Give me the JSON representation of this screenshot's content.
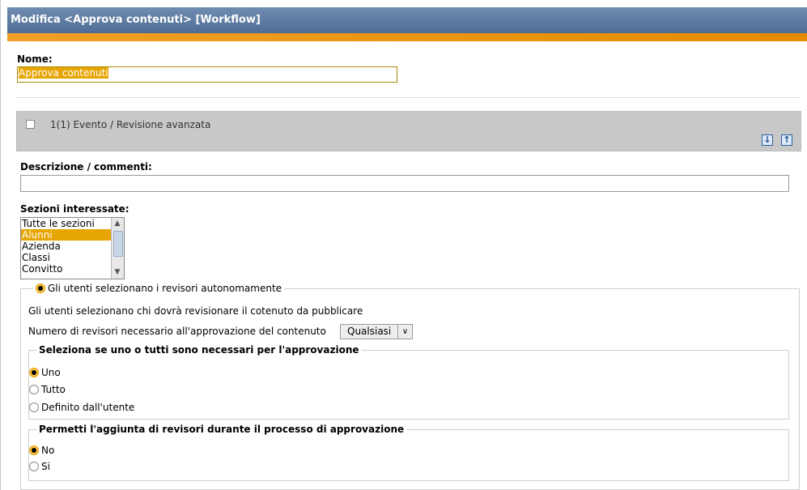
{
  "window": {
    "title": "Modifica <Approva contenuti> [Workflow]"
  },
  "form": {
    "name_label": "Nome:",
    "name_value": "Approva contenuti",
    "step": {
      "label": "1(1) Evento / Revisione avanzata",
      "move_down_icon": "arrow-down-icon",
      "move_up_icon": "arrow-up-icon"
    },
    "description_label": "Descrizione / commenti:",
    "description_value": "",
    "sections_label": "Sezioni interessate:",
    "sections_options": [
      {
        "label": "Tutte le sezioni",
        "selected": false
      },
      {
        "label": "Alunni",
        "selected": true
      },
      {
        "label": "Azienda",
        "selected": false
      },
      {
        "label": "Classi",
        "selected": false
      },
      {
        "label": "Convitto",
        "selected": false
      }
    ],
    "reviewer_mode": {
      "label": "Gli utenti selezionano i revisori autonomamente",
      "selected": true,
      "info": "Gli utenti selezionano chi dovrà revisionare il cotenuto da pubblicare",
      "count_label": "Numero di revisori necessario all'approvazione del contenuto",
      "count_value": "Qualsiasi"
    },
    "approval_group": {
      "legend": "Seleziona se uno o tutti sono necessari per l'approvazione",
      "options": [
        "Uno",
        "Tutto",
        "Definito dall'utente"
      ],
      "selected": "Uno"
    },
    "add_reviewers_group": {
      "legend": "Permetti l'aggiunta di revisori durante il processo di approvazione",
      "options": [
        "No",
        "Si"
      ],
      "selected": "No"
    }
  },
  "colors": {
    "titlebar": "#5c7aa0",
    "accent_orange": "#e68a00",
    "selection": "#e6a500"
  }
}
